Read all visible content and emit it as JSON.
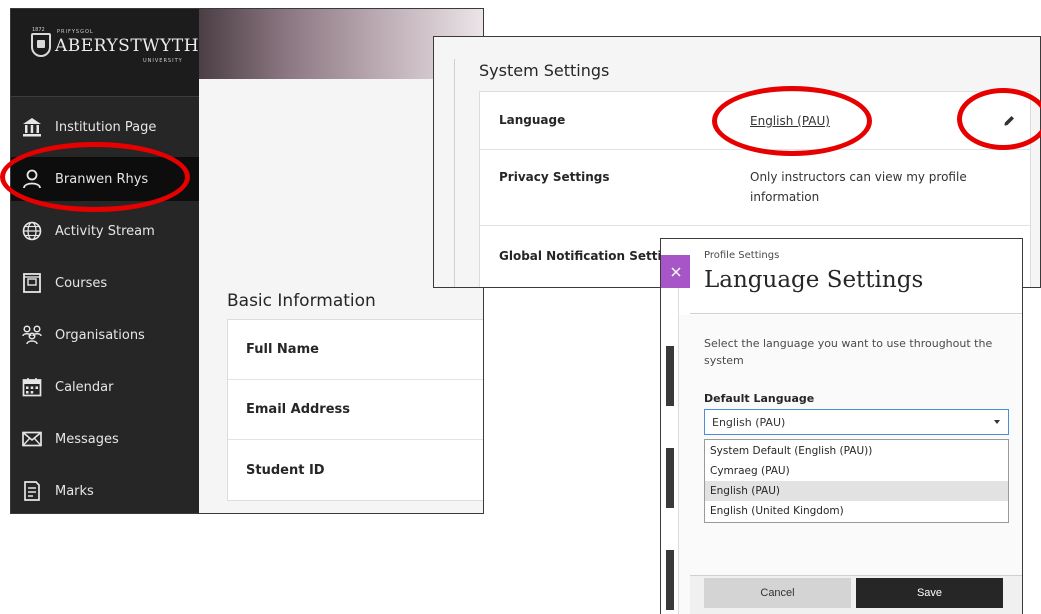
{
  "main_panel": {
    "logo": {
      "year": "1872",
      "small_top": "PRIFYSGOL",
      "name": "ABERYSTWYTH",
      "small_bottom": "UNIVERSITY"
    },
    "sidebar": {
      "items": [
        {
          "label": "Institution Page",
          "icon": "institution-icon"
        },
        {
          "label": "Branwen Rhys",
          "icon": "user-icon",
          "active": true
        },
        {
          "label": "Activity Stream",
          "icon": "globe-icon"
        },
        {
          "label": "Courses",
          "icon": "courses-icon"
        },
        {
          "label": "Organisations",
          "icon": "organisations-icon"
        },
        {
          "label": "Calendar",
          "icon": "calendar-icon"
        },
        {
          "label": "Messages",
          "icon": "envelope-icon"
        },
        {
          "label": "Marks",
          "icon": "marks-icon"
        }
      ]
    },
    "basic_information": {
      "title": "Basic Information",
      "rows": [
        "Full Name",
        "Email Address",
        "Student ID"
      ]
    }
  },
  "system_settings": {
    "title": "System Settings",
    "rows": [
      {
        "label": "Language",
        "value": "English (PAU)"
      },
      {
        "label": "Privacy Settings",
        "value": "Only instructors can view my profile information"
      },
      {
        "label": "Global Notification Settin",
        "value": ""
      }
    ],
    "edit_icon": "pencil-icon"
  },
  "language_settings": {
    "breadcrumb": "Profile Settings",
    "title": "Language Settings",
    "description": "Select the language you want to use throughout the system",
    "field_label": "Default Language",
    "selected_value": "English (PAU)",
    "options": [
      "System Default (English (PAU))",
      "Cymraeg (PAU)",
      "English (PAU)",
      "English (United Kingdom)"
    ],
    "highlighted_option_index": 2,
    "cancel_label": "Cancel",
    "save_label": "Save"
  },
  "colors": {
    "sidebar_bg": "#262626",
    "active_bg": "#0d0d0d",
    "highlight_red": "#e60000",
    "close_tab_purple": "#a855c8",
    "select_border": "#4a8fd6"
  }
}
